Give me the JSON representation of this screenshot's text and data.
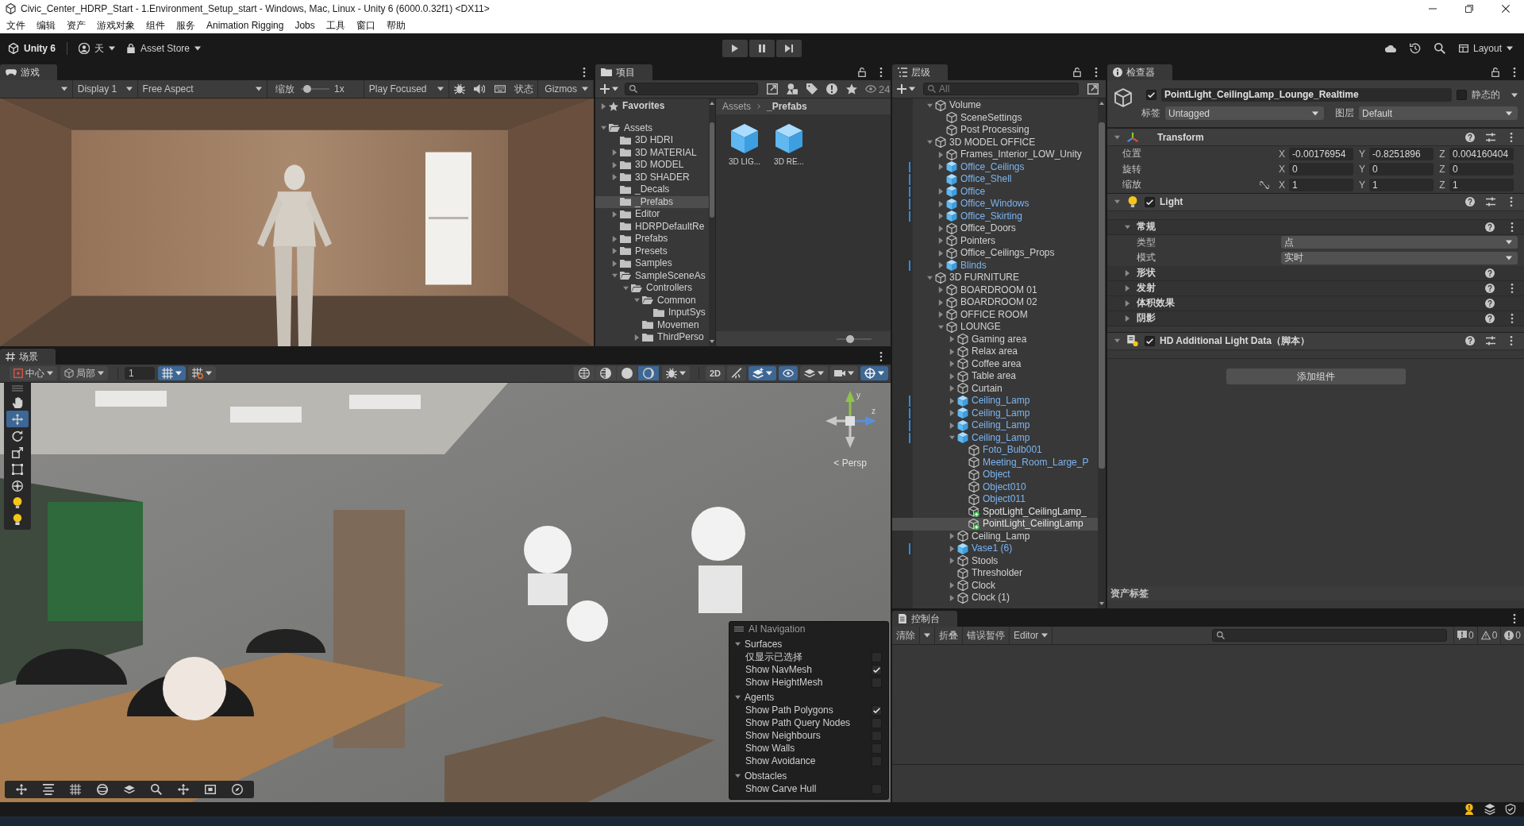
{
  "window": {
    "title": "Civic_Center_HDRP_Start - 1.Environment_Setup_start - Windows, Mac, Linux - Unity 6 (6000.0.32f1) <DX11>",
    "controls": [
      {
        "kind": "minimize"
      },
      {
        "kind": "maximize"
      },
      {
        "kind": "close"
      }
    ]
  },
  "menu_bar": [
    "文件",
    "编辑",
    "资产",
    "游戏对象",
    "组件",
    "服务",
    "Animation Rigging",
    "Jobs",
    "工具",
    "窗口",
    "帮助"
  ],
  "main_toolbar": {
    "product": "Unity 6",
    "account": "天",
    "asset_store": "Asset Store",
    "play_controls": [
      {
        "kind": "play"
      },
      {
        "kind": "pause"
      },
      {
        "kind": "step"
      }
    ],
    "tools": [
      {
        "kind": "cloud"
      },
      {
        "kind": "history"
      },
      {
        "kind": "search"
      }
    ],
    "layout": "Layout"
  },
  "game_view": {
    "tab": "游戏",
    "display": "Display 1",
    "aspect": "Free Aspect",
    "scale_label": "缩放",
    "scale": {
      "level": 0.1
    },
    "scale_reading": "1x",
    "play_mode": "Play Focused",
    "toggles": [
      {
        "kind": "debug"
      },
      {
        "kind": "audio"
      },
      {
        "kind": "keyboard"
      }
    ],
    "stats": "状态",
    "gizmos": "Gizmos"
  },
  "project": {
    "tab": "项目",
    "visible_count": "24",
    "favorites": {
      "label": "Favorites",
      "expanded": false,
      "selected": false
    },
    "tree": [
      {
        "label": "Assets",
        "expanded": true,
        "selected": false,
        "children": [
          {
            "label": "3D HDRI",
            "selected": false
          },
          {
            "label": "3D MATERIAL",
            "expanded": false,
            "selected": false
          },
          {
            "label": "3D MODEL",
            "expanded": false,
            "selected": false
          },
          {
            "label": "3D SHADER",
            "expanded": false,
            "selected": false
          },
          {
            "label": "_Decals",
            "selected": false
          },
          {
            "label": "_Prefabs",
            "selected": true
          },
          {
            "label": "Editor",
            "expanded": false,
            "selected": false
          },
          {
            "label": "HDRPDefaultRe",
            "selected": false
          },
          {
            "label": "Prefabs",
            "expanded": false,
            "selected": false
          },
          {
            "label": "Presets",
            "expanded": false,
            "selected": false
          },
          {
            "label": "Samples",
            "expanded": false,
            "selected": false
          },
          {
            "label": "SampleSceneAs",
            "expanded": true,
            "selected": false,
            "children": [
              {
                "label": "Controllers",
                "expanded": true,
                "selected": false,
                "children": [
                  {
                    "label": "Common",
                    "expanded": true,
                    "selected": false,
                    "children": [
                      {
                        "label": "InputSys",
                        "selected": false
                      }
                    ]
                  },
                  {
                    "label": "Movemen",
                    "selected": false
                  },
                  {
                    "label": "ThirdPerso",
                    "expanded": false,
                    "selected": false
                  }
                ]
              }
            ]
          }
        ]
      }
    ],
    "breadcrumb": [
      "Assets",
      "_Prefabs"
    ],
    "assets": [
      {
        "label": "3D LIG..."
      },
      {
        "label": "3D RE..."
      }
    ],
    "icon_size": {
      "level": 0.35
    }
  },
  "hierarchy": {
    "tab": "层级",
    "search_placeholder": "All",
    "tree": [
      {
        "label": "Volume",
        "kind": "object",
        "expanded": true,
        "selected": false,
        "children": [
          {
            "label": "SceneSettings",
            "kind": "object",
            "selected": false
          },
          {
            "label": "Post Processing",
            "kind": "object",
            "selected": false
          }
        ]
      },
      {
        "label": "3D MODEL OFFICE",
        "kind": "object",
        "expanded": true,
        "selected": false,
        "children": [
          {
            "label": "Frames_Interior_LOW_Unity",
            "kind": "object",
            "expanded": false,
            "selected": false
          },
          {
            "label": "Office_Ceilings",
            "kind": "prefab",
            "expanded": false,
            "selected": false
          },
          {
            "label": "Office_Shell",
            "kind": "prefab",
            "selected": false
          },
          {
            "label": "Office",
            "kind": "prefab",
            "expanded": false,
            "selected": false
          },
          {
            "label": "Office_Windows",
            "kind": "prefab",
            "expanded": false,
            "selected": false
          },
          {
            "label": "Office_Skirting",
            "kind": "prefab",
            "expanded": false,
            "selected": false
          },
          {
            "label": "Office_Doors",
            "kind": "object",
            "expanded": false,
            "selected": false
          },
          {
            "label": "Pointers",
            "kind": "object",
            "expanded": false,
            "selected": false
          },
          {
            "label": "Office_Ceilings_Props",
            "kind": "object",
            "expanded": false,
            "selected": false
          },
          {
            "label": "Blinds",
            "kind": "prefab",
            "expanded": false,
            "selected": false
          }
        ]
      },
      {
        "label": "3D FURNITURE",
        "kind": "object",
        "expanded": true,
        "selected": false,
        "children": [
          {
            "label": "BOARDROOM 01",
            "kind": "object",
            "expanded": false,
            "selected": false
          },
          {
            "label": "BOARDROOM 02",
            "kind": "object",
            "expanded": false,
            "selected": false
          },
          {
            "label": "OFFICE ROOM",
            "kind": "object",
            "expanded": false,
            "selected": false
          },
          {
            "label": "LOUNGE",
            "kind": "object",
            "expanded": true,
            "selected": false,
            "children": [
              {
                "label": "Gaming area",
                "kind": "object",
                "expanded": false,
                "selected": false
              },
              {
                "label": "Relax area",
                "kind": "object",
                "expanded": false,
                "selected": false
              },
              {
                "label": "Coffee area",
                "kind": "object",
                "expanded": false,
                "selected": false
              },
              {
                "label": "Table area",
                "kind": "object",
                "expanded": false,
                "selected": false
              },
              {
                "label": "Curtain",
                "kind": "object",
                "expanded": false,
                "selected": false
              },
              {
                "label": "Ceiling_Lamp",
                "kind": "prefab",
                "expanded": false,
                "selected": false
              },
              {
                "label": "Ceiling_Lamp",
                "kind": "prefab",
                "expanded": false,
                "selected": false
              },
              {
                "label": "Ceiling_Lamp",
                "kind": "prefab",
                "expanded": false,
                "selected": false
              },
              {
                "label": "Ceiling_Lamp",
                "kind": "prefab",
                "expanded": true,
                "selected": false,
                "children": [
                  {
                    "label": "Foto_Bulb001",
                    "kind": "prefab_part",
                    "selected": false
                  },
                  {
                    "label": "Meeting_Room_Large_P",
                    "kind": "prefab_part",
                    "selected": false
                  },
                  {
                    "label": "Object",
                    "kind": "prefab_part",
                    "selected": false
                  },
                  {
                    "label": "Object010",
                    "kind": "prefab_part",
                    "selected": false
                  },
                  {
                    "label": "Object011",
                    "kind": "prefab_part",
                    "selected": false
                  },
                  {
                    "label": "SpotLight_CeilingLamp_",
                    "kind": "added",
                    "selected": false
                  },
                  {
                    "label": "PointLight_CeilingLamp",
                    "kind": "added",
                    "selected": true
                  }
                ]
              },
              {
                "label": "Ceiling_Lamp",
                "kind": "object",
                "expanded": false,
                "selected": false
              },
              {
                "label": "Vase1 (6)",
                "kind": "prefab",
                "expanded": false,
                "selected": false
              },
              {
                "label": "Stools",
                "kind": "object",
                "expanded": false,
                "selected": false
              },
              {
                "label": "Thresholder",
                "kind": "object",
                "selected": false
              },
              {
                "label": "Clock",
                "kind": "object",
                "expanded": false,
                "selected": false
              },
              {
                "label": "Clock (1)",
                "kind": "object",
                "expanded": false,
                "selected": false
              }
            ]
          }
        ]
      }
    ]
  },
  "inspector": {
    "tab": "检查器",
    "object": {
      "active": true,
      "name": "PointLight_CeilingLamp_Lounge_Realtime",
      "static": false,
      "static_label": "静态的",
      "tag_label": "标签",
      "tag": "Untagged",
      "layer_label": "图层",
      "layer": "Default"
    },
    "components": [
      {
        "kind": "transform",
        "title": "Transform",
        "expanded": true,
        "rows": [
          {
            "label": "位置",
            "values": [
              {
                "axis": "X",
                "value": "-0.00176954"
              },
              {
                "axis": "Y",
                "value": "-0.8251896"
              },
              {
                "axis": "Z",
                "value": "0.004160404"
              }
            ]
          },
          {
            "label": "旋转",
            "values": [
              {
                "axis": "X",
                "value": "0"
              },
              {
                "axis": "Y",
                "value": "0"
              },
              {
                "axis": "Z",
                "value": "0"
              }
            ]
          },
          {
            "label": "缩放",
            "proportions_locked": false,
            "values": [
              {
                "axis": "X",
                "value": "1"
              },
              {
                "axis": "Y",
                "value": "1"
              },
              {
                "axis": "Z",
                "value": "1"
              }
            ]
          }
        ]
      },
      {
        "kind": "light",
        "title": "Light",
        "enabled": true,
        "expanded": true,
        "sections": [
          {
            "title": "常规",
            "expanded": true,
            "menu": true,
            "fields": [
              {
                "label": "类型",
                "value": "点"
              },
              {
                "label": "模式",
                "value": "实时"
              }
            ]
          },
          {
            "title": "形状",
            "expanded": false,
            "menu": false
          },
          {
            "title": "发射",
            "expanded": false,
            "menu": true
          },
          {
            "title": "体积效果",
            "expanded": false,
            "menu": false
          },
          {
            "title": "阴影",
            "expanded": false,
            "menu": true
          }
        ]
      },
      {
        "kind": "script",
        "title": "HD Additional Light Data（脚本）",
        "enabled": true,
        "expanded": true
      }
    ],
    "add_component": "添加组件",
    "asset_labels": "资产标签"
  },
  "scene_view": {
    "tab": "场景",
    "pivot": "中心",
    "space": "局部",
    "snap_increment": "1",
    "snap_toggles": [
      {
        "kind": "grid",
        "selected": true
      },
      {
        "kind": "increment",
        "selected": false
      }
    ],
    "draw_modes": [
      {
        "kind": "wireframe",
        "selected": false
      },
      {
        "kind": "shaded_wireframe",
        "selected": false
      },
      {
        "kind": "shaded",
        "selected": false
      },
      {
        "kind": "unlit",
        "selected": true
      }
    ],
    "view_toggles": [
      {
        "kind": "flat",
        "label": "2D",
        "selected": false
      },
      {
        "kind": "lighting",
        "selected": false
      },
      {
        "kind": "effects",
        "selected": true
      },
      {
        "kind": "visibility",
        "selected": true
      },
      {
        "kind": "layers",
        "selected": false
      },
      {
        "kind": "camera",
        "selected": false
      },
      {
        "kind": "gizmos",
        "selected": true
      }
    ],
    "tools": [
      {
        "kind": "view",
        "selected": false
      },
      {
        "kind": "move",
        "selected": true
      },
      {
        "kind": "rotate",
        "selected": false
      },
      {
        "kind": "scale",
        "selected": false
      },
      {
        "kind": "rect",
        "selected": false
      },
      {
        "kind": "transform",
        "selected": false
      },
      {
        "kind": "light",
        "selected": false
      },
      {
        "kind": "light_probe",
        "selected": false
      }
    ],
    "gizmo": {
      "axes": [
        "y",
        "z"
      ],
      "projection": "< Persp"
    },
    "ai_navigation": {
      "title": "AI Navigation",
      "sections": [
        {
          "title": "Surfaces",
          "expanded": true,
          "options": [
            {
              "label": "仅显示已选择",
              "checked": false
            },
            {
              "label": "Show NavMesh",
              "checked": true
            },
            {
              "label": "Show HeightMesh",
              "checked": false
            }
          ]
        },
        {
          "title": "Agents",
          "expanded": true,
          "options": [
            {
              "label": "Show Path Polygons",
              "checked": true
            },
            {
              "label": "Show Path Query Nodes",
              "checked": false
            },
            {
              "label": "Show Neighbours",
              "checked": false
            },
            {
              "label": "Show Walls",
              "checked": false
            },
            {
              "label": "Show Avoidance",
              "checked": false
            }
          ]
        },
        {
          "title": "Obstacles",
          "expanded": true,
          "options": [
            {
              "label": "Show Carve Hull",
              "checked": false
            }
          ]
        }
      ]
    },
    "bottom_tools": [
      {
        "kind": "move"
      },
      {
        "kind": "align"
      },
      {
        "kind": "grid"
      },
      {
        "kind": "orbit"
      },
      {
        "kind": "layers"
      },
      {
        "kind": "zoom"
      },
      {
        "kind": "pan"
      },
      {
        "kind": "frame"
      },
      {
        "kind": "compass"
      }
    ]
  },
  "console": {
    "tab": "控制台",
    "clear": "清除",
    "collapse": "折叠",
    "error_pause": "错误暂停",
    "target": "Editor",
    "counts": [
      {
        "kind": "info",
        "count": "0"
      },
      {
        "kind": "warning",
        "count": "0"
      },
      {
        "kind": "error",
        "count": "0"
      }
    ]
  },
  "status_bar": {
    "icons": [
      {
        "kind": "alert"
      },
      {
        "kind": "stack"
      },
      {
        "kind": "shield"
      }
    ]
  }
}
